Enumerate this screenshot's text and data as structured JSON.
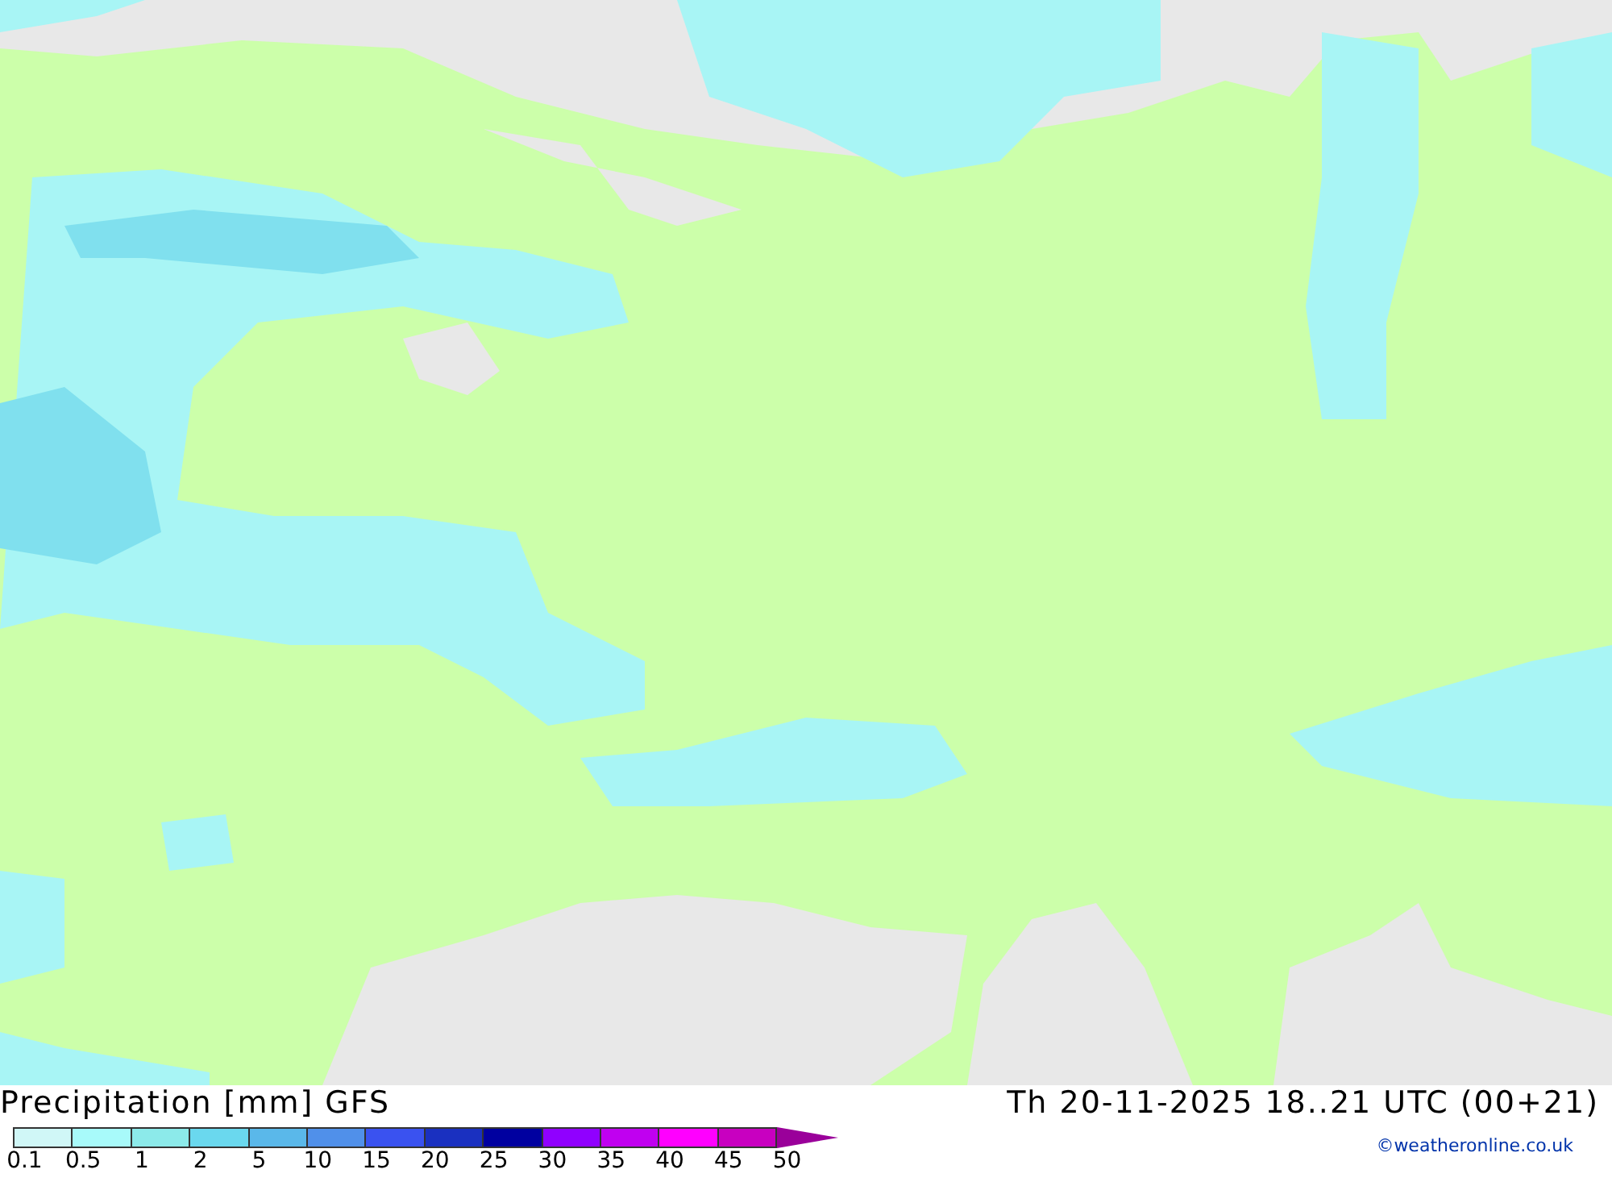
{
  "map": {
    "title": "Precipitation [mm] GFS",
    "valid_time": "Th 20-11-2025 18..21 UTC (00+21)"
  },
  "legend": {
    "bins": [
      {
        "color": "#d0f7f7"
      },
      {
        "color": "#a8fafa"
      },
      {
        "color": "#8ceaea"
      },
      {
        "color": "#6ad8ee"
      },
      {
        "color": "#5ab8ea"
      },
      {
        "color": "#5090ea"
      },
      {
        "color": "#3a52f0"
      },
      {
        "color": "#1a30c0"
      },
      {
        "color": "#0000a0"
      },
      {
        "color": "#9000ff"
      },
      {
        "color": "#c000f0"
      },
      {
        "color": "#ff00ff"
      },
      {
        "color": "#c800c0"
      },
      {
        "kind": "arrow",
        "color": "#9a009a"
      }
    ],
    "labels": [
      "0.1",
      "0.5",
      "1",
      "2",
      "5",
      "10",
      "15",
      "20",
      "25",
      "30",
      "35",
      "40",
      "45",
      "50"
    ]
  },
  "credit": "©weatheronline.co.uk"
}
